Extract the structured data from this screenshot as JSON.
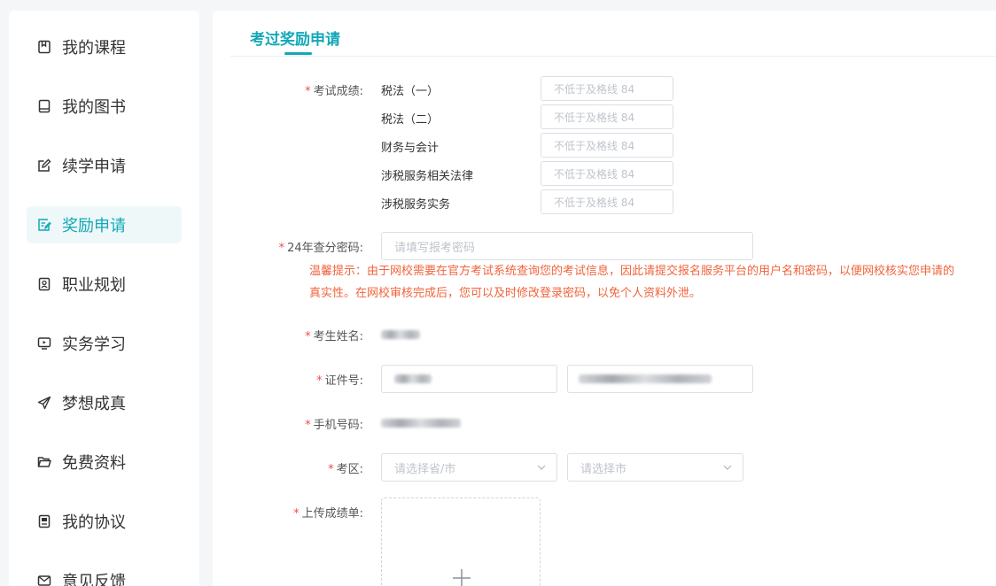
{
  "sidebar": {
    "items": [
      {
        "label": "我的课程",
        "icon": "bookmark-icon",
        "active": false
      },
      {
        "label": "我的图书",
        "icon": "book-icon",
        "active": false
      },
      {
        "label": "续学申请",
        "icon": "edit-icon",
        "active": false
      },
      {
        "label": "奖励申请",
        "icon": "form-edit-icon",
        "active": true
      },
      {
        "label": "职业规划",
        "icon": "id-card-icon",
        "active": false
      },
      {
        "label": "实务学习",
        "icon": "monitor-icon",
        "active": false
      },
      {
        "label": "梦想成真",
        "icon": "paper-plane-icon",
        "active": false
      },
      {
        "label": "免费资料",
        "icon": "folder-icon",
        "active": false
      },
      {
        "label": "我的协议",
        "icon": "document-icon",
        "active": false
      },
      {
        "label": "意见反馈",
        "icon": "mail-icon",
        "active": false
      }
    ]
  },
  "main": {
    "tab_title": "考过奖励申请",
    "form": {
      "score_label": "考试成绩:",
      "subjects": [
        {
          "name": "税法（一）",
          "placeholder": "不低于及格线 84"
        },
        {
          "name": "税法（二）",
          "placeholder": "不低于及格线 84"
        },
        {
          "name": "财务与会计",
          "placeholder": "不低于及格线 84"
        },
        {
          "name": "涉税服务相关法律",
          "placeholder": "不低于及格线 84"
        },
        {
          "name": "涉税服务实务",
          "placeholder": "不低于及格线 84"
        }
      ],
      "password_label": "24年查分密码:",
      "password_placeholder": "请填写报考密码",
      "hint": "温馨提示：由于网校需要在官方考试系统查询您的考试信息，因此请提交报名服务平台的用户名和密码，以便网校核实您申请的真实性。在网校审核完成后，您可以及时修改登录密码，以免个人资料外泄。",
      "name_label": "考生姓名:",
      "id_label": "证件号:",
      "phone_label": "手机号码:",
      "region_label": "考区:",
      "province_placeholder": "请选择省/市",
      "city_placeholder": "请选择市",
      "upload_label": "上传成绩单:",
      "required_mark": "*"
    }
  },
  "colors": {
    "accent": "#12a8b8",
    "required": "#f04b4b",
    "hint": "#f0643c"
  }
}
